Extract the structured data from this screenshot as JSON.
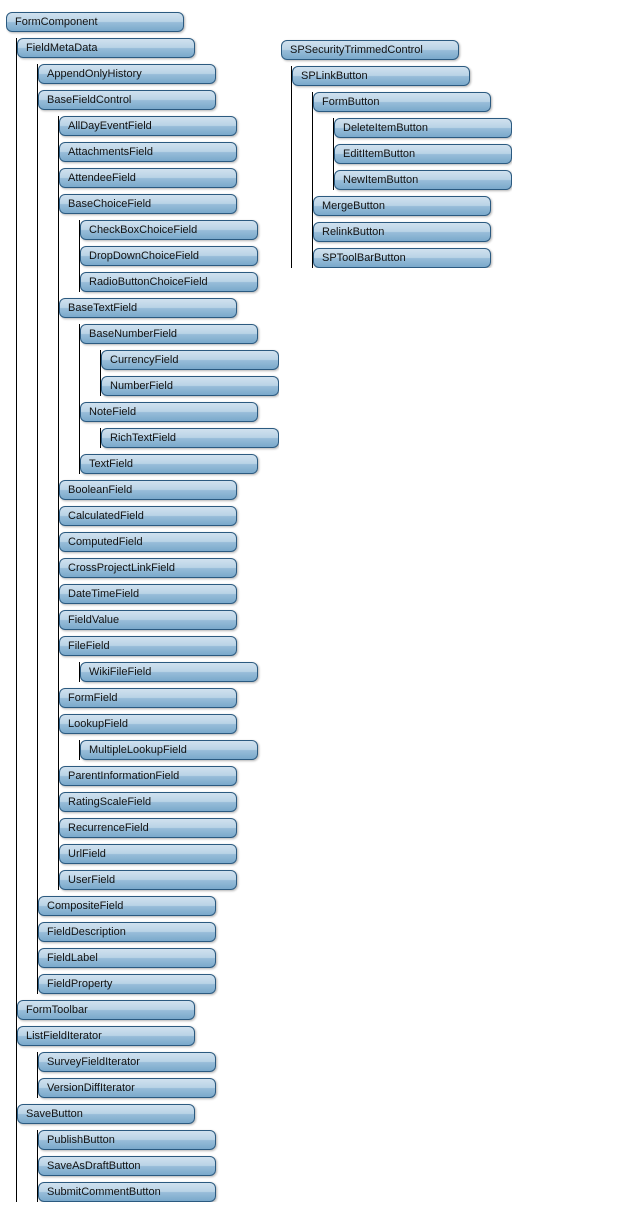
{
  "left": {
    "label": "FormComponent",
    "children": [
      {
        "label": "FieldMetaData",
        "children": [
          {
            "label": "AppendOnlyHistory"
          },
          {
            "label": "BaseFieldControl",
            "children": [
              {
                "label": "AllDayEventField"
              },
              {
                "label": "AttachmentsField"
              },
              {
                "label": "AttendeeField"
              },
              {
                "label": "BaseChoiceField",
                "children": [
                  {
                    "label": "CheckBoxChoiceField"
                  },
                  {
                    "label": "DropDownChoiceField"
                  },
                  {
                    "label": "RadioButtonChoiceField"
                  }
                ]
              },
              {
                "label": "BaseTextField",
                "children": [
                  {
                    "label": "BaseNumberField",
                    "children": [
                      {
                        "label": "CurrencyField"
                      },
                      {
                        "label": "NumberField"
                      }
                    ]
                  },
                  {
                    "label": "NoteField",
                    "children": [
                      {
                        "label": "RichTextField"
                      }
                    ]
                  },
                  {
                    "label": "TextField"
                  }
                ]
              },
              {
                "label": "BooleanField"
              },
              {
                "label": "CalculatedField"
              },
              {
                "label": "ComputedField"
              },
              {
                "label": "CrossProjectLinkField"
              },
              {
                "label": "DateTimeField"
              },
              {
                "label": "FieldValue"
              },
              {
                "label": "FileField",
                "children": [
                  {
                    "label": "WikiFileField"
                  }
                ]
              },
              {
                "label": "FormField"
              },
              {
                "label": "LookupField",
                "children": [
                  {
                    "label": "MultipleLookupField"
                  }
                ]
              },
              {
                "label": "ParentInformationField"
              },
              {
                "label": "RatingScaleField"
              },
              {
                "label": "RecurrenceField"
              },
              {
                "label": "UrlField"
              },
              {
                "label": "UserField"
              }
            ]
          },
          {
            "label": "CompositeField"
          },
          {
            "label": "FieldDescription"
          },
          {
            "label": "FieldLabel"
          },
          {
            "label": "FieldProperty"
          }
        ]
      },
      {
        "label": "FormToolbar"
      },
      {
        "label": "ListFieldIterator",
        "children": [
          {
            "label": "SurveyFieldIterator"
          },
          {
            "label": "VersionDiffIterator"
          }
        ]
      },
      {
        "label": "SaveButton",
        "children": [
          {
            "label": "PublishButton"
          },
          {
            "label": "SaveAsDraftButton"
          },
          {
            "label": "SubmitCommentButton"
          }
        ]
      }
    ]
  },
  "right": {
    "label": "SPSecurityTrimmedControl",
    "children": [
      {
        "label": "SPLinkButton",
        "children": [
          {
            "label": "FormButton",
            "children": [
              {
                "label": "DeleteItemButton"
              },
              {
                "label": "EditItemButton"
              },
              {
                "label": "NewItemButton"
              }
            ]
          },
          {
            "label": "MergeButton"
          },
          {
            "label": "RelinkButton"
          },
          {
            "label": "SPToolBarButton"
          }
        ]
      }
    ]
  },
  "chart_data": {
    "type": "tree",
    "description": "Two class-hierarchy trees of SharePoint form/field controls.",
    "trees": [
      {
        "root": "FormComponent",
        "edges": [
          [
            "FormComponent",
            "FieldMetaData"
          ],
          [
            "FormComponent",
            "FormToolbar"
          ],
          [
            "FormComponent",
            "ListFieldIterator"
          ],
          [
            "FormComponent",
            "SaveButton"
          ],
          [
            "FieldMetaData",
            "AppendOnlyHistory"
          ],
          [
            "FieldMetaData",
            "BaseFieldControl"
          ],
          [
            "FieldMetaData",
            "CompositeField"
          ],
          [
            "FieldMetaData",
            "FieldDescription"
          ],
          [
            "FieldMetaData",
            "FieldLabel"
          ],
          [
            "FieldMetaData",
            "FieldProperty"
          ],
          [
            "BaseFieldControl",
            "AllDayEventField"
          ],
          [
            "BaseFieldControl",
            "AttachmentsField"
          ],
          [
            "BaseFieldControl",
            "AttendeeField"
          ],
          [
            "BaseFieldControl",
            "BaseChoiceField"
          ],
          [
            "BaseFieldControl",
            "BaseTextField"
          ],
          [
            "BaseFieldControl",
            "BooleanField"
          ],
          [
            "BaseFieldControl",
            "CalculatedField"
          ],
          [
            "BaseFieldControl",
            "ComputedField"
          ],
          [
            "BaseFieldControl",
            "CrossProjectLinkField"
          ],
          [
            "BaseFieldControl",
            "DateTimeField"
          ],
          [
            "BaseFieldControl",
            "FieldValue"
          ],
          [
            "BaseFieldControl",
            "FileField"
          ],
          [
            "BaseFieldControl",
            "FormField"
          ],
          [
            "BaseFieldControl",
            "LookupField"
          ],
          [
            "BaseFieldControl",
            "ParentInformationField"
          ],
          [
            "BaseFieldControl",
            "RatingScaleField"
          ],
          [
            "BaseFieldControl",
            "RecurrenceField"
          ],
          [
            "BaseFieldControl",
            "UrlField"
          ],
          [
            "BaseFieldControl",
            "UserField"
          ],
          [
            "BaseChoiceField",
            "CheckBoxChoiceField"
          ],
          [
            "BaseChoiceField",
            "DropDownChoiceField"
          ],
          [
            "BaseChoiceField",
            "RadioButtonChoiceField"
          ],
          [
            "BaseTextField",
            "BaseNumberField"
          ],
          [
            "BaseTextField",
            "NoteField"
          ],
          [
            "BaseTextField",
            "TextField"
          ],
          [
            "BaseNumberField",
            "CurrencyField"
          ],
          [
            "BaseNumberField",
            "NumberField"
          ],
          [
            "NoteField",
            "RichTextField"
          ],
          [
            "FileField",
            "WikiFileField"
          ],
          [
            "LookupField",
            "MultipleLookupField"
          ],
          [
            "ListFieldIterator",
            "SurveyFieldIterator"
          ],
          [
            "ListFieldIterator",
            "VersionDiffIterator"
          ],
          [
            "SaveButton",
            "PublishButton"
          ],
          [
            "SaveButton",
            "SaveAsDraftButton"
          ],
          [
            "SaveButton",
            "SubmitCommentButton"
          ]
        ]
      },
      {
        "root": "SPSecurityTrimmedControl",
        "edges": [
          [
            "SPSecurityTrimmedControl",
            "SPLinkButton"
          ],
          [
            "SPLinkButton",
            "FormButton"
          ],
          [
            "SPLinkButton",
            "MergeButton"
          ],
          [
            "SPLinkButton",
            "RelinkButton"
          ],
          [
            "SPLinkButton",
            "SPToolBarButton"
          ],
          [
            "FormButton",
            "DeleteItemButton"
          ],
          [
            "FormButton",
            "EditItemButton"
          ],
          [
            "FormButton",
            "NewItemButton"
          ]
        ]
      }
    ]
  }
}
